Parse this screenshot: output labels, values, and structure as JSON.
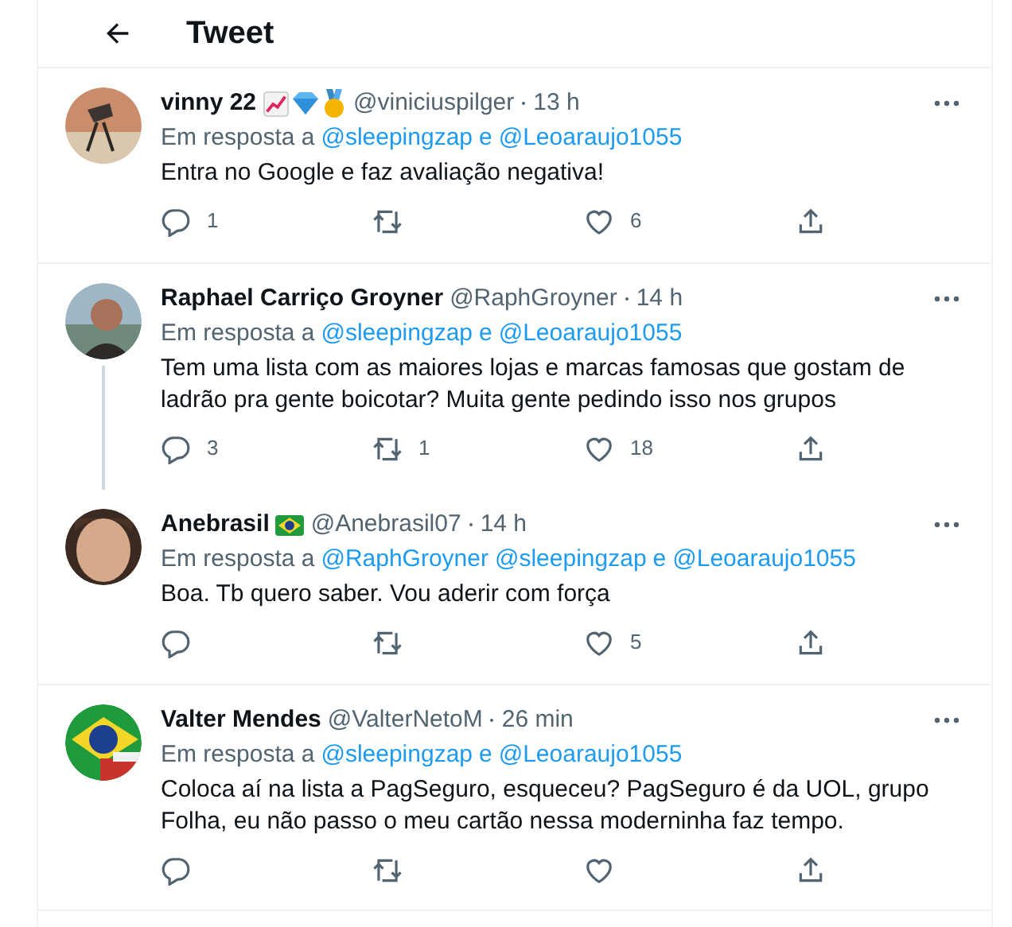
{
  "header": {
    "title": "Tweet"
  },
  "tweets": [
    {
      "name": "vinny 22",
      "name_icons": [
        {
          "kind": "chart"
        },
        {
          "kind": "diamond"
        },
        {
          "kind": "medal"
        }
      ],
      "handle": "@viniciuspilger",
      "time": "13 h",
      "reply_prefix": "Em resposta a",
      "reply_to": [
        "@sleepingzap",
        "@Leoaraujo1055"
      ],
      "reply_joiner": "e",
      "text": "Entra no Google e faz avaliação negativa!",
      "thread_line": false,
      "actions": {
        "replies": "1",
        "likes": "6"
      }
    },
    {
      "name": "Raphael Carriço Groyner",
      "handle": "@RaphGroyner",
      "time": "14 h",
      "reply_prefix": "Em resposta a",
      "reply_to": [
        "@sleepingzap",
        "@Leoaraujo1055"
      ],
      "reply_joiner": "e",
      "text": "Tem uma lista com as maiores lojas e marcas famosas que gostam de ladrão pra gente boicotar? Muita gente pedindo isso nos grupos",
      "thread_line": true,
      "actions": {
        "replies": "3",
        "retweets": "1",
        "likes": "18"
      }
    },
    {
      "name": "Anebrasil",
      "name_icons": [
        {
          "kind": "flag"
        }
      ],
      "handle": "@Anebrasil07",
      "time": "14 h",
      "reply_prefix": "Em resposta a",
      "reply_to": [
        "@RaphGroyner",
        "@sleepingzap",
        "@Leoaraujo1055"
      ],
      "reply_joiner": "e",
      "text": "Boa. Tb quero saber. Vou aderir com força",
      "thread_line": false,
      "actions": {
        "likes": "5"
      }
    },
    {
      "name": "Valter Mendes",
      "handle": "@ValterNetoM",
      "time": "26 min",
      "reply_prefix": "Em resposta a",
      "reply_to": [
        "@sleepingzap",
        "@Leoaraujo1055"
      ],
      "reply_joiner": "e",
      "text": "Coloca aí na lista a PagSeguro, esqueceu? PagSeguro é da UOL, grupo Folha, eu não passo o meu cartão nessa moderninha faz tempo.",
      "thread_line": false
    }
  ]
}
